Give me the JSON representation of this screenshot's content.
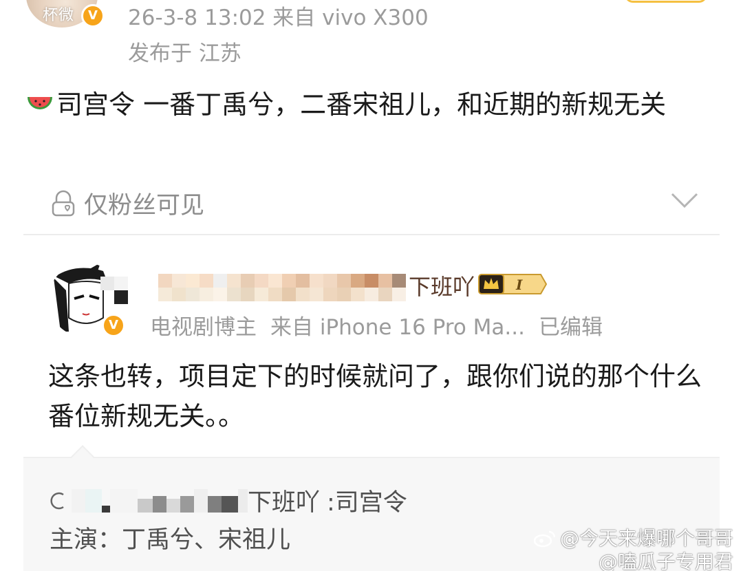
{
  "post": {
    "avatar_name": "杯微",
    "time_source": "26-3-8 13:02  来自 vivo X300",
    "location": "发布于 江苏",
    "content": "司宫令 一番丁禹兮，二番宋祖儿，和近期的新规无关",
    "visibility": "仅粉丝可见"
  },
  "repost": {
    "username_tail": "下班吖",
    "meta_role": "电视剧博主",
    "meta_device": "来自 iPhone 16 Pro Ma...",
    "meta_edited": "已编辑",
    "content": "这条也转，项目定下的时候就问了，跟你们说的那个什么番位新规无关。。"
  },
  "quoted": {
    "author_tail": "下班吖",
    "line1_text": ":司宫令",
    "line2_text": "主演：丁禹兮、宋祖儿"
  },
  "watermark": {
    "line1": "@今天来爆哪个哥哥",
    "line2": "@嗑瓜子专用君"
  },
  "colors": {
    "meta_gray": "#9b9b9b",
    "verified_orange": "#f7a41a",
    "badge_gold": "#f5c041"
  }
}
